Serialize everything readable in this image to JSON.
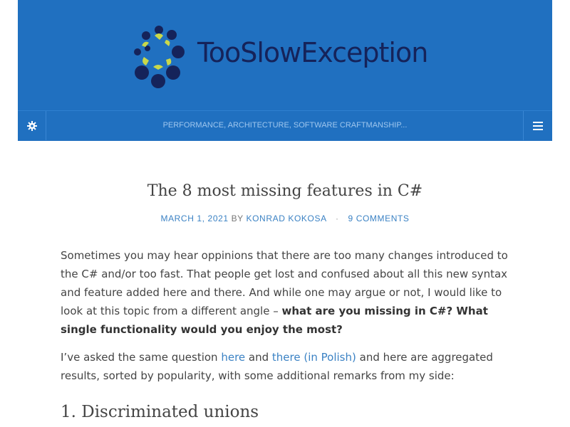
{
  "site": {
    "name": "TooSlowException",
    "tagline": "PERFORMANCE, ARCHITECTURE, SOFTWARE CRAFTMANSHIP...",
    "colors": {
      "header": "#2070c0",
      "logo_dark": "#15235a",
      "logo_accent": "#c9d84a",
      "link": "#3b82c4"
    },
    "icons": {
      "settings": "gear-icon",
      "menu": "hamburger-menu-icon"
    }
  },
  "post": {
    "title": "The 8 most missing features in C#",
    "date": "MARCH 1, 2021",
    "by": "BY",
    "author": "KONRAD KOKOSA",
    "sep": "·",
    "comments": "9 COMMENTS",
    "p1": {
      "text": "Sometimes you may hear oppinions that there are too many changes introduced to the C# and/or too fast. That people get lost and confused about all this new syntax and feature added here and there. And while one may argue or not, I would like to look at this topic from a different angle – ",
      "bold": "what are you missing in C#? What single functionality would you enjoy the most?"
    },
    "p2": {
      "t1": "I’ve asked the same question ",
      "link1": "here",
      "t2": " and ",
      "link2": "there (in Polish)",
      "t3": " and here are aggregated results, sorted by popularity, with some additional remarks from my side:"
    },
    "h2": "1. Discriminated unions"
  }
}
